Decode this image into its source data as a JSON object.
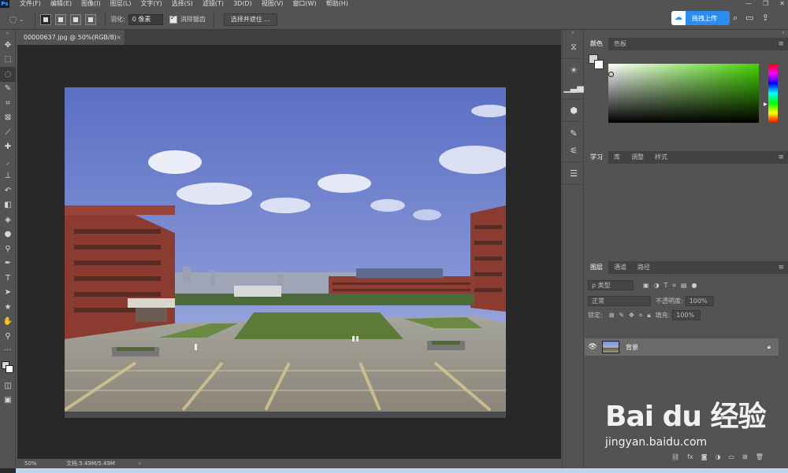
{
  "menubar": {
    "logo": "Ps",
    "items": [
      "文件(F)",
      "编辑(E)",
      "图像(I)",
      "图层(L)",
      "文字(Y)",
      "选择(S)",
      "滤镜(T)",
      "3D(D)",
      "视图(V)",
      "窗口(W)",
      "帮助(H)"
    ],
    "window_minimize": "—",
    "window_restore": "❐",
    "window_close": "✕"
  },
  "options": {
    "tool_icon": "lasso-icon",
    "feather_label": "羽化:",
    "feather_value": "0 像素",
    "antialias_label": "消除锯齿",
    "select_mask_button": "选择并遮住 ...",
    "upload_button": "拖拽上传"
  },
  "document": {
    "tab_title": "00000637.jpg @ 50%(RGB/8)",
    "tab_close": "×"
  },
  "status": {
    "zoom": "50%",
    "doc_size": "文档:5.49M/5.49M",
    "arrow": "›"
  },
  "panels": {
    "color_tabs": [
      "颜色",
      "色板"
    ],
    "learn_tabs": [
      "学习",
      "库",
      "调整",
      "样式"
    ],
    "layers_tabs": [
      "图层",
      "通道",
      "路径"
    ],
    "filter_kind": "ρ 类型",
    "blend_mode": "正常",
    "opacity_label": "不透明度:",
    "opacity_value": "100%",
    "lock_label": "锁定:",
    "fill_label": "填充:",
    "fill_value": "100%",
    "layer_name": "背景"
  },
  "watermark": {
    "title": "Bai du 经验",
    "subtitle": "jingyan.baidu.com"
  },
  "colors": {
    "accent": "#2d8cf0",
    "panel_bg": "#535353",
    "canvas_bg": "#282828"
  }
}
